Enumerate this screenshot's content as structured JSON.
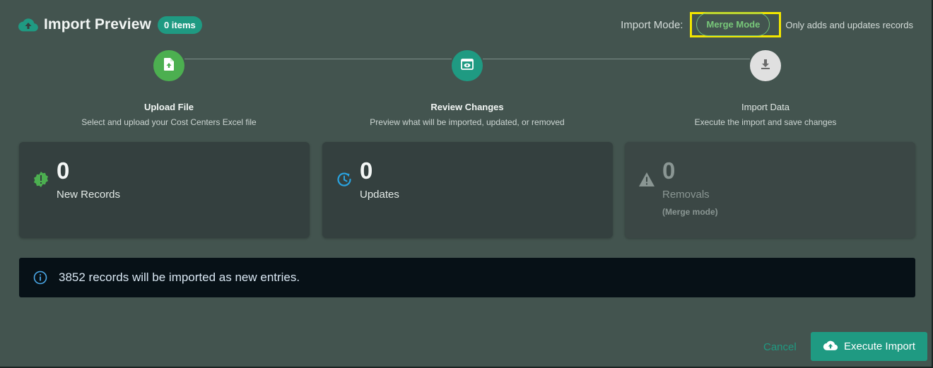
{
  "header": {
    "icon": "cloud-upload-icon",
    "title": "Import Preview",
    "count_badge": "0 items"
  },
  "import_mode": {
    "label": "Import Mode:",
    "value": "Merge Mode",
    "description": "Only adds and updates records",
    "highlight_color": "#f2e600"
  },
  "steps": [
    {
      "title": "Upload File",
      "description": "Select and upload your Cost Centers Excel file",
      "icon": "file-upload-icon",
      "status": "complete",
      "color": "#4caf50"
    },
    {
      "title": "Review Changes",
      "description": "Preview what will be imported, updated, or removed",
      "icon": "preview-icon",
      "status": "active",
      "color": "#1f9a82"
    },
    {
      "title": "Import Data",
      "description": "Execute the import and save changes",
      "icon": "download-icon",
      "status": "pending",
      "color": "#e0e0e0"
    }
  ],
  "stats": [
    {
      "value": "0",
      "label": "New Records",
      "icon": "new-badge-icon",
      "color": "#4caf50"
    },
    {
      "value": "0",
      "label": "Updates",
      "icon": "update-clock-icon",
      "color": "#29a3e0"
    },
    {
      "value": "0",
      "label": "Removals",
      "sublabel": "(Merge mode)",
      "icon": "warning-icon",
      "color": "#8a9693"
    }
  ],
  "banner": {
    "icon": "info-icon",
    "message": "3852 records will be imported as new entries."
  },
  "footer": {
    "cancel_label": "Cancel",
    "execute_label": "Execute Import",
    "execute_icon": "cloud-upload-icon",
    "accent": "#1f9a82"
  }
}
